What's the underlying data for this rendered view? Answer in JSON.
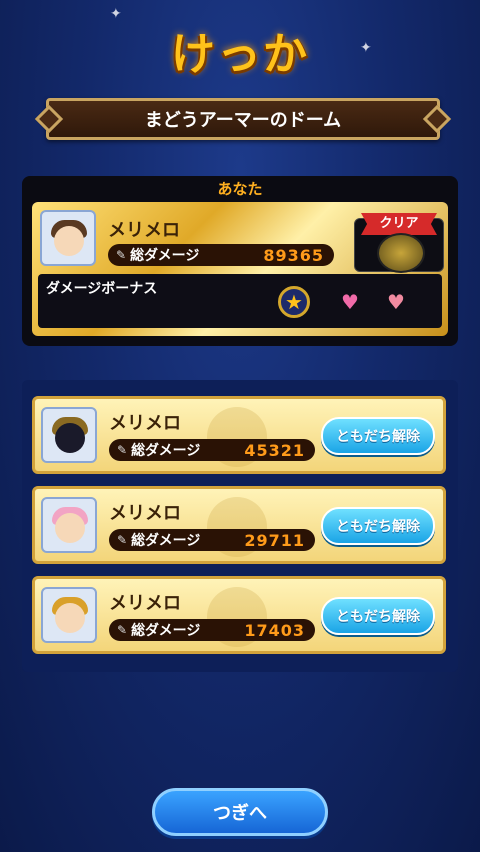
{
  "title": "けっか",
  "stage_name": "まどうアーマーのドーム",
  "you": {
    "label": "あなた",
    "name": "メリメロ",
    "damage_label": "総ダメージ",
    "damage_value": "89365",
    "bonus_label": "ダメージボーナス",
    "clear_label": "クリア"
  },
  "friends": [
    {
      "name": "メリメロ",
      "damage_label": "総ダメージ",
      "damage_value": "45321",
      "button_label": "ともだち解除"
    },
    {
      "name": "メリメロ",
      "damage_label": "総ダメージ",
      "damage_value": "29711",
      "button_label": "ともだち解除"
    },
    {
      "name": "メリメロ",
      "damage_label": "総ダメージ",
      "damage_value": "17403",
      "button_label": "ともだち解除"
    }
  ],
  "next_button": "つぎへ",
  "colors": {
    "title": "#ffc21a",
    "accent_orange": "#ff9b1a",
    "button_blue": "#1aa4e6"
  }
}
